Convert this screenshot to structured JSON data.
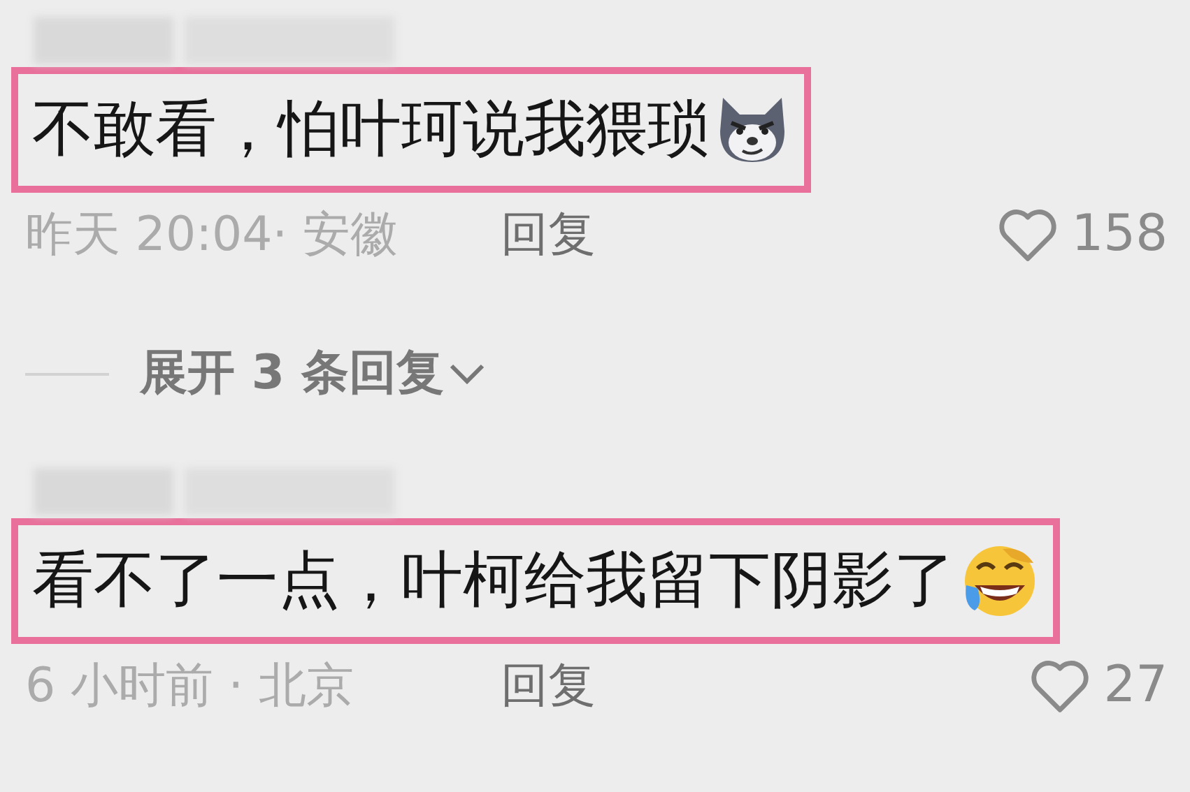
{
  "comments": [
    {
      "text": "不敢看，怕叶珂说我猥琐",
      "highlighted": true,
      "time": "昨天 20:04· 安徽",
      "reply": "回复",
      "likes": "158",
      "liked": false,
      "expand": {
        "label": "展开 3 条回复"
      }
    },
    {
      "text": "看不了一点，叶柯给我留下阴影了",
      "highlighted": true,
      "time": "6 小时前 · 北京",
      "reply": "回复",
      "likes": "27",
      "liked": false
    }
  ]
}
